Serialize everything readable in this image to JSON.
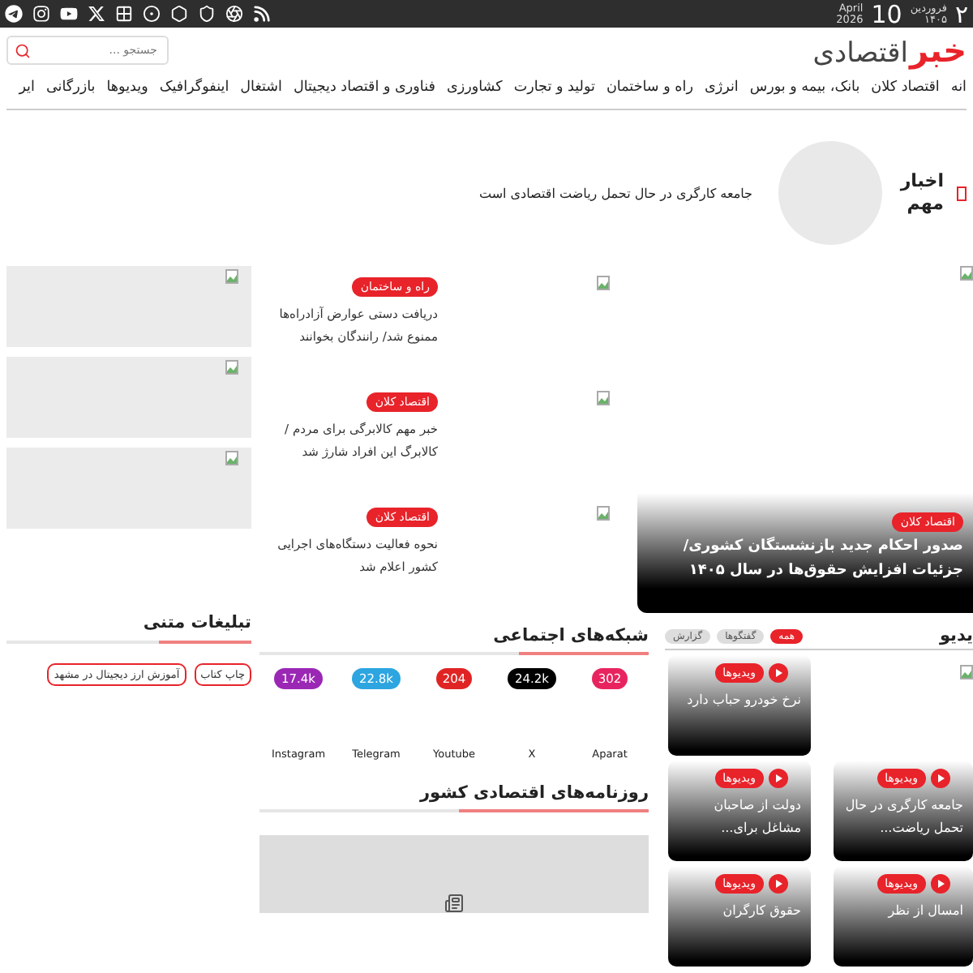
{
  "top_bar": {
    "day": "۲",
    "month": "فروردین",
    "year": "۱۴۰۵",
    "day_en": "10",
    "month_en": "April",
    "year_en": "2026"
  },
  "header": {
    "logo_mark": "خبر",
    "logo_text": "اقتصادی",
    "search": {
      "placeholder": "جستجو ..."
    }
  },
  "nav": [
    "انه",
    "اقتصاد کلان",
    "بانک، بیمه و بورس",
    "انرژی",
    "راه و ساختمان",
    "تولید و تجارت",
    "کشاورزی",
    "فناوری و اقتصاد دیجیتال",
    "اشتغال",
    "اینفوگرافیک",
    "ویدیوها",
    "بازرگانی",
    "ایر"
  ],
  "breaking": {
    "label": "اخبار مهم",
    "headline": "جامعه کارگری در حال تحمل ریاضت اقتصادی است"
  },
  "hero": {
    "tag": "اقتصاد کلان",
    "title": "صدور احکام جدید بازنشستگان کشوری/ جزئیات افزایش حقوق‌ها در سال ۱۴۰۵"
  },
  "news": [
    {
      "tag": "راه و ساختمان",
      "title": "دریافت دستی عوارض آزادراه‌ها ممنوع شد/ رانندگان بخوانند"
    },
    {
      "tag": "اقتصاد کلان",
      "title": "خبر مهم کالابرگی برای مردم / کالابرگ این افراد شارژ شد"
    },
    {
      "tag": "اقتصاد کلان",
      "title": "نحوه فعالیت دستگاه‌های اجرایی کشور اعلام شد"
    }
  ],
  "video": {
    "title": "یدیو",
    "filters": [
      {
        "label": "همه",
        "selected": true
      },
      {
        "label": "گفتگوها",
        "selected": false
      },
      {
        "label": "گزارش",
        "selected": false
      }
    ],
    "cards": [
      {
        "kind": "image"
      },
      {
        "kind": "video",
        "tag": "ویدیوها",
        "title": "نرخ خودرو حباب دارد"
      },
      {
        "kind": "video",
        "tag": "ویدیوها",
        "title": "جامعه کارگری در حال تحمل ریاضت..."
      },
      {
        "kind": "video",
        "tag": "ویدیوها",
        "title": "دولت از صاحبان مشاغل برای..."
      },
      {
        "kind": "video",
        "tag": "ویدیوها",
        "title": "امسال از نظر"
      },
      {
        "kind": "video",
        "tag": "ویدیوها",
        "title": "حقوق کارگران"
      }
    ]
  },
  "social": {
    "title": "شبکه‌های اجتماعی",
    "items": [
      {
        "name": "Aparat",
        "count": "302",
        "color": "#e8245f"
      },
      {
        "name": "X",
        "count": "24.2k",
        "color": "#000000"
      },
      {
        "name": "Youtube",
        "count": "204",
        "color": "#e02424"
      },
      {
        "name": "Telegram",
        "count": "22.8k",
        "color": "#2ca5e0"
      },
      {
        "name": "Instagram",
        "count": "17.4k",
        "color": "#9b27b5"
      }
    ]
  },
  "newspapers": {
    "title": "روزنامه‌های اقتصادی کشور"
  },
  "text_ads": {
    "title": "تبلیغات متنی",
    "links": [
      "چاپ کتاب",
      "آموزش ارز دیجیتال در مشهد"
    ]
  }
}
